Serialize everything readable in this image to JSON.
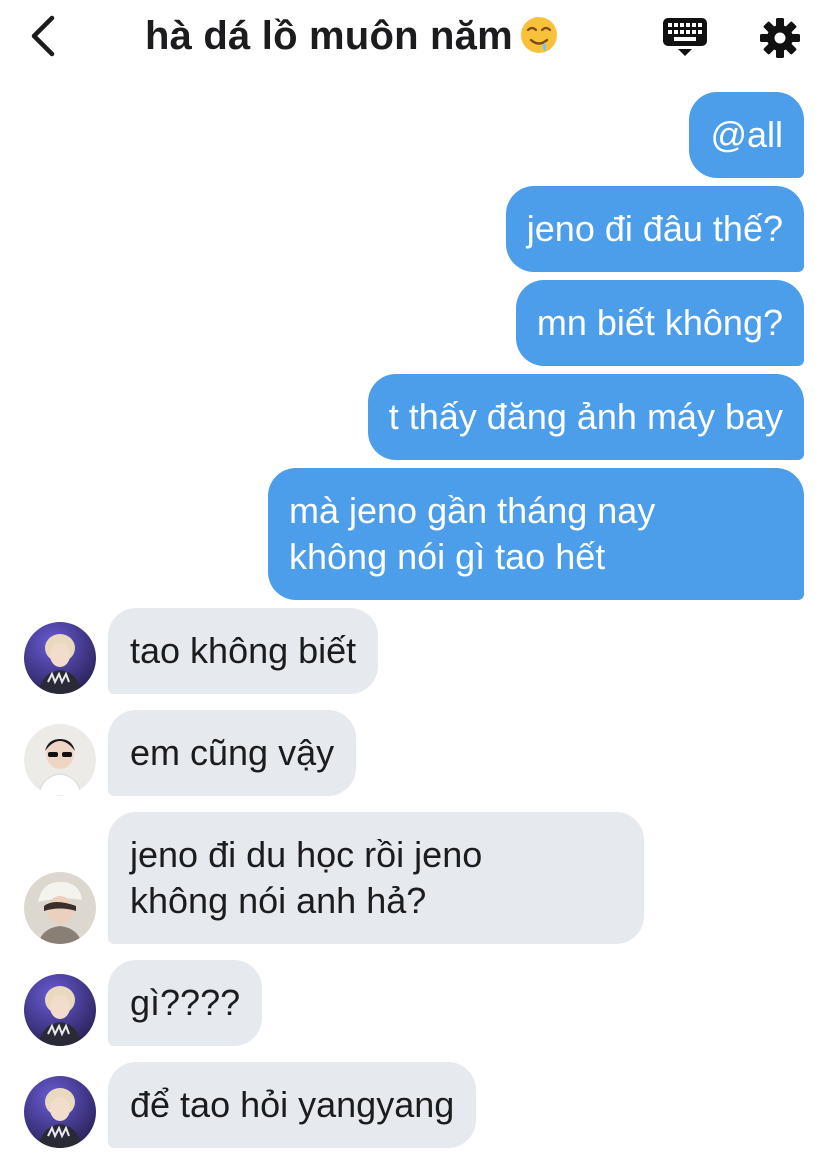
{
  "header": {
    "title": "hà dá lồ muôn năm",
    "title_emoji": "drooling-face-emoji"
  },
  "colors": {
    "outgoing_bubble": "#4c9eea",
    "incoming_bubble": "#e6e9ee"
  },
  "messages": [
    {
      "direction": "outgoing",
      "text": "@all"
    },
    {
      "direction": "outgoing",
      "text": "jeno đi đâu thế?"
    },
    {
      "direction": "outgoing",
      "text": "mn biết không?"
    },
    {
      "direction": "outgoing",
      "text": "t thấy đăng ảnh máy bay"
    },
    {
      "direction": "outgoing",
      "lines": [
        "mà jeno gần tháng nay",
        "không nói gì tao hết"
      ]
    },
    {
      "direction": "incoming",
      "text": "tao không biết"
    },
    {
      "direction": "incoming",
      "text": "em cũng vậy"
    },
    {
      "direction": "incoming",
      "lines": [
        "jeno đi du học rồi jeno",
        "không nói anh hả?"
      ]
    },
    {
      "direction": "incoming",
      "text": "gì????"
    },
    {
      "direction": "incoming",
      "text": "để tao hỏi yangyang"
    }
  ]
}
